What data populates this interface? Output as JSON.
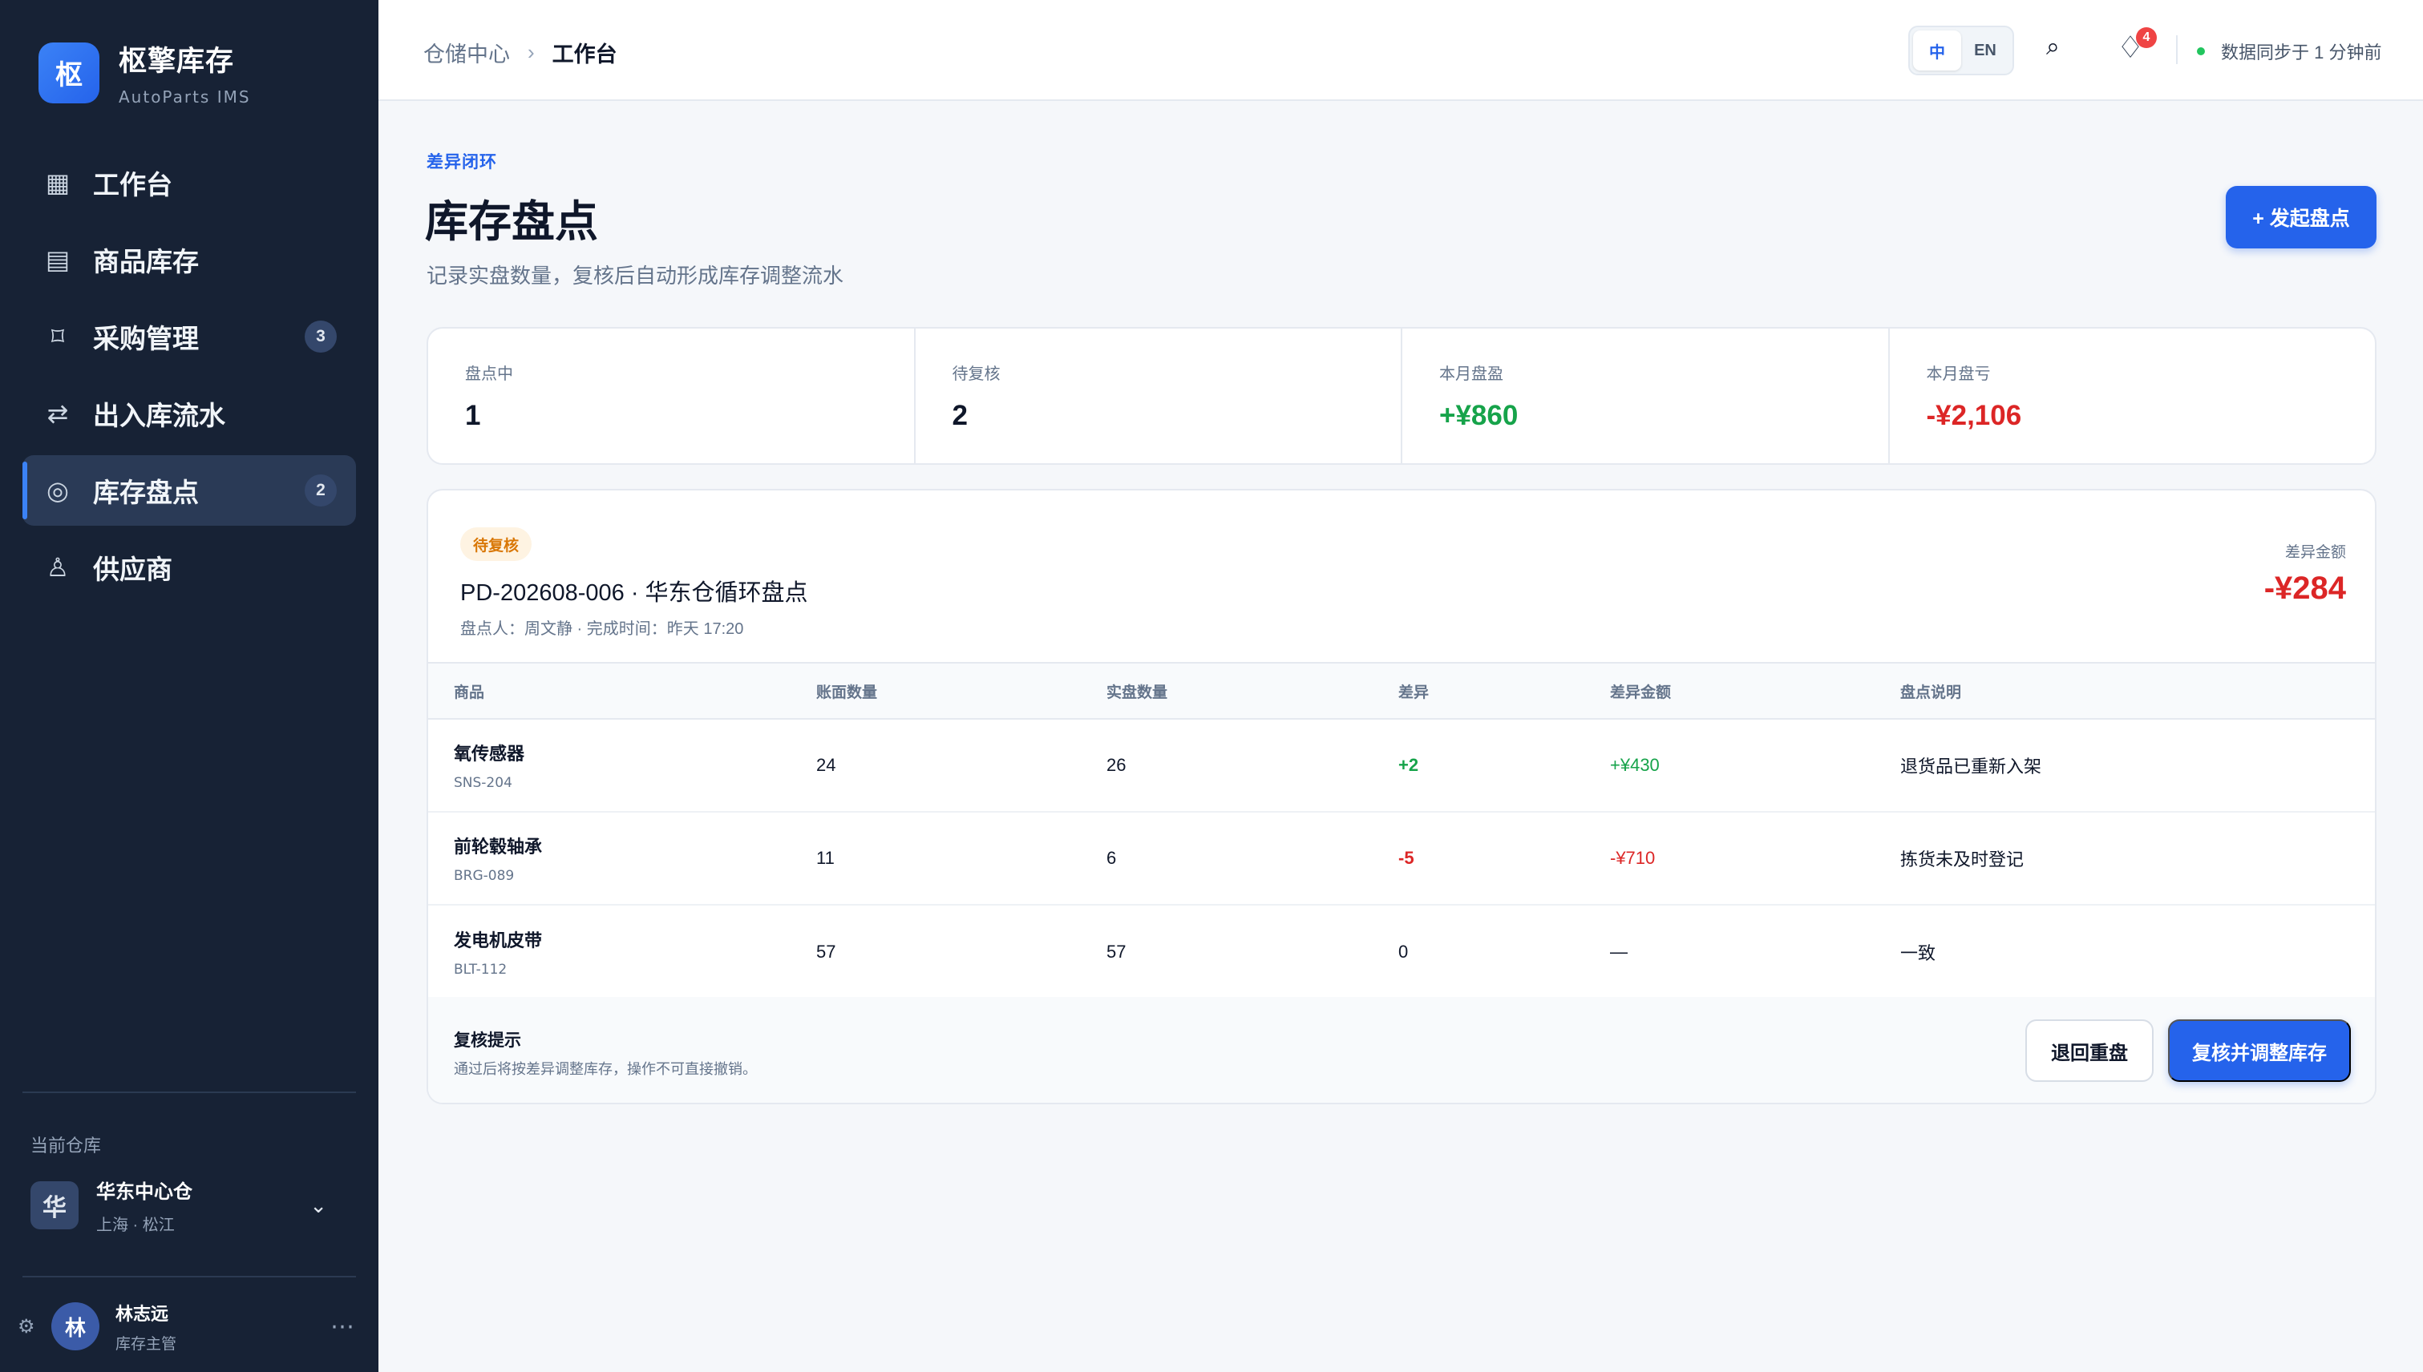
{
  "brand": {
    "logo_char": "枢",
    "title": "枢擎库存",
    "subtitle": "AutoParts IMS"
  },
  "sidebar": {
    "items": [
      {
        "icon": "grid-icon",
        "glyph": "▦",
        "label": "工作台",
        "badge": ""
      },
      {
        "icon": "list-icon",
        "glyph": "▤",
        "label": "商品库存",
        "badge": ""
      },
      {
        "icon": "cart-icon",
        "glyph": "⌑",
        "label": "采购管理",
        "badge": "3"
      },
      {
        "icon": "swap-icon",
        "glyph": "⇄",
        "label": "出入库流水",
        "badge": ""
      },
      {
        "icon": "target-icon",
        "glyph": "◎",
        "label": "库存盘点",
        "badge": "2",
        "active": true
      },
      {
        "icon": "supplier-icon",
        "glyph": "♙",
        "label": "供应商",
        "badge": ""
      }
    ],
    "warehouse": {
      "section_label": "当前仓库",
      "avatar": "华",
      "name": "华东中心仓",
      "location": "上海 · 松江"
    },
    "user": {
      "avatar": "林",
      "name": "林志远",
      "role": "库存主管"
    }
  },
  "topbar": {
    "breadcrumb_root": "仓储中心",
    "breadcrumb_sep": "›",
    "breadcrumb_current": "工作台",
    "lang_zh": "中",
    "lang_en": "EN",
    "notification_count": "4",
    "sync_status": "数据同步于 1 分钟前"
  },
  "page": {
    "eyebrow": "差异闭环",
    "title": "库存盘点",
    "description": "记录实盘数量，复核后自动形成库存调整流水",
    "primary_action": "+ 发起盘点"
  },
  "stats": [
    {
      "label": "盘点中",
      "value": "1",
      "tone": "neutral"
    },
    {
      "label": "待复核",
      "value": "2",
      "tone": "neutral"
    },
    {
      "label": "本月盘盈",
      "value": "+¥860",
      "tone": "pos"
    },
    {
      "label": "本月盘亏",
      "value": "-¥2,106",
      "tone": "neg"
    }
  ],
  "count_card": {
    "status_tag": "待复核",
    "title": "PD-202608-006 · 华东仓循环盘点",
    "meta": "盘点人：周文静 · 完成时间：昨天 17:20",
    "diff_label": "差异金额",
    "diff_value": "-¥284",
    "columns": [
      "商品",
      "账面数量",
      "实盘数量",
      "差异",
      "差异金额",
      "盘点说明"
    ],
    "rows": [
      {
        "name": "氧传感器",
        "sku": "SNS-204",
        "book": "24",
        "actual": "26",
        "diff": "+2",
        "amount": "+¥430",
        "note": "退货品已重新入架",
        "tone": "pos"
      },
      {
        "name": "前轮毂轴承",
        "sku": "BRG-089",
        "book": "11",
        "actual": "6",
        "diff": "-5",
        "amount": "-¥710",
        "note": "拣货未及时登记",
        "tone": "neg"
      },
      {
        "name": "发电机皮带",
        "sku": "BLT-112",
        "book": "57",
        "actual": "57",
        "diff": "0",
        "amount": "—",
        "note": "一致",
        "tone": "neutral"
      }
    ],
    "footer": {
      "title": "复核提示",
      "description": "通过后将按差异调整库存，操作不可直接撤销。",
      "secondary_action": "退回重盘",
      "primary_action": "复核并调整库存"
    }
  },
  "colors": {
    "accent": "#2563eb",
    "sidebar_bg": "#172235",
    "positive": "#16a34a",
    "negative": "#dc2626",
    "warning": "#d97706"
  }
}
